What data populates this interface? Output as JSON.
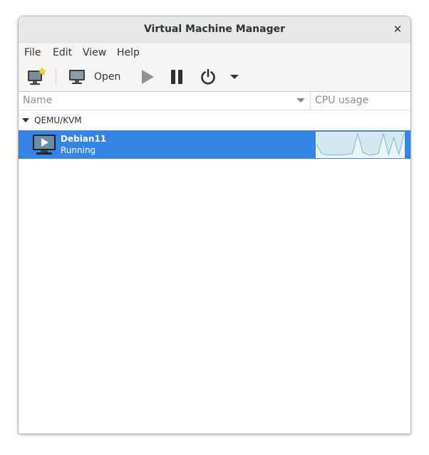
{
  "window": {
    "title": "Virtual Machine Manager"
  },
  "menubar": {
    "items": [
      "File",
      "Edit",
      "View",
      "Help"
    ]
  },
  "toolbar": {
    "buttons": [
      {
        "icon": "new-vm-icon"
      },
      {
        "icon": "monitor-icon",
        "label": "Open"
      },
      {
        "icon": "play-icon"
      },
      {
        "icon": "pause-icon"
      },
      {
        "icon": "power-icon"
      },
      {
        "icon": "dropdown-arrow-icon"
      }
    ]
  },
  "columns": {
    "name": "Name",
    "cpu": "CPU usage"
  },
  "connections": [
    {
      "label": "QEMU/KVM",
      "vms": [
        {
          "name": "Debian11",
          "status": "Running",
          "icon": "vm-running-icon",
          "cpu_usage_history": [
            0.55,
            0.15,
            0.1,
            0.1,
            0.1,
            0.1,
            0.12,
            0.15,
            0.95,
            0.2,
            0.1,
            0.1,
            0.15,
            0.95,
            0.1,
            0.8,
            0.1,
            0.95
          ]
        }
      ]
    }
  ],
  "colors": {
    "selection": "#3584e4",
    "graph_bg": "#d2e8ee",
    "graph_line": "#7fb6c9"
  }
}
